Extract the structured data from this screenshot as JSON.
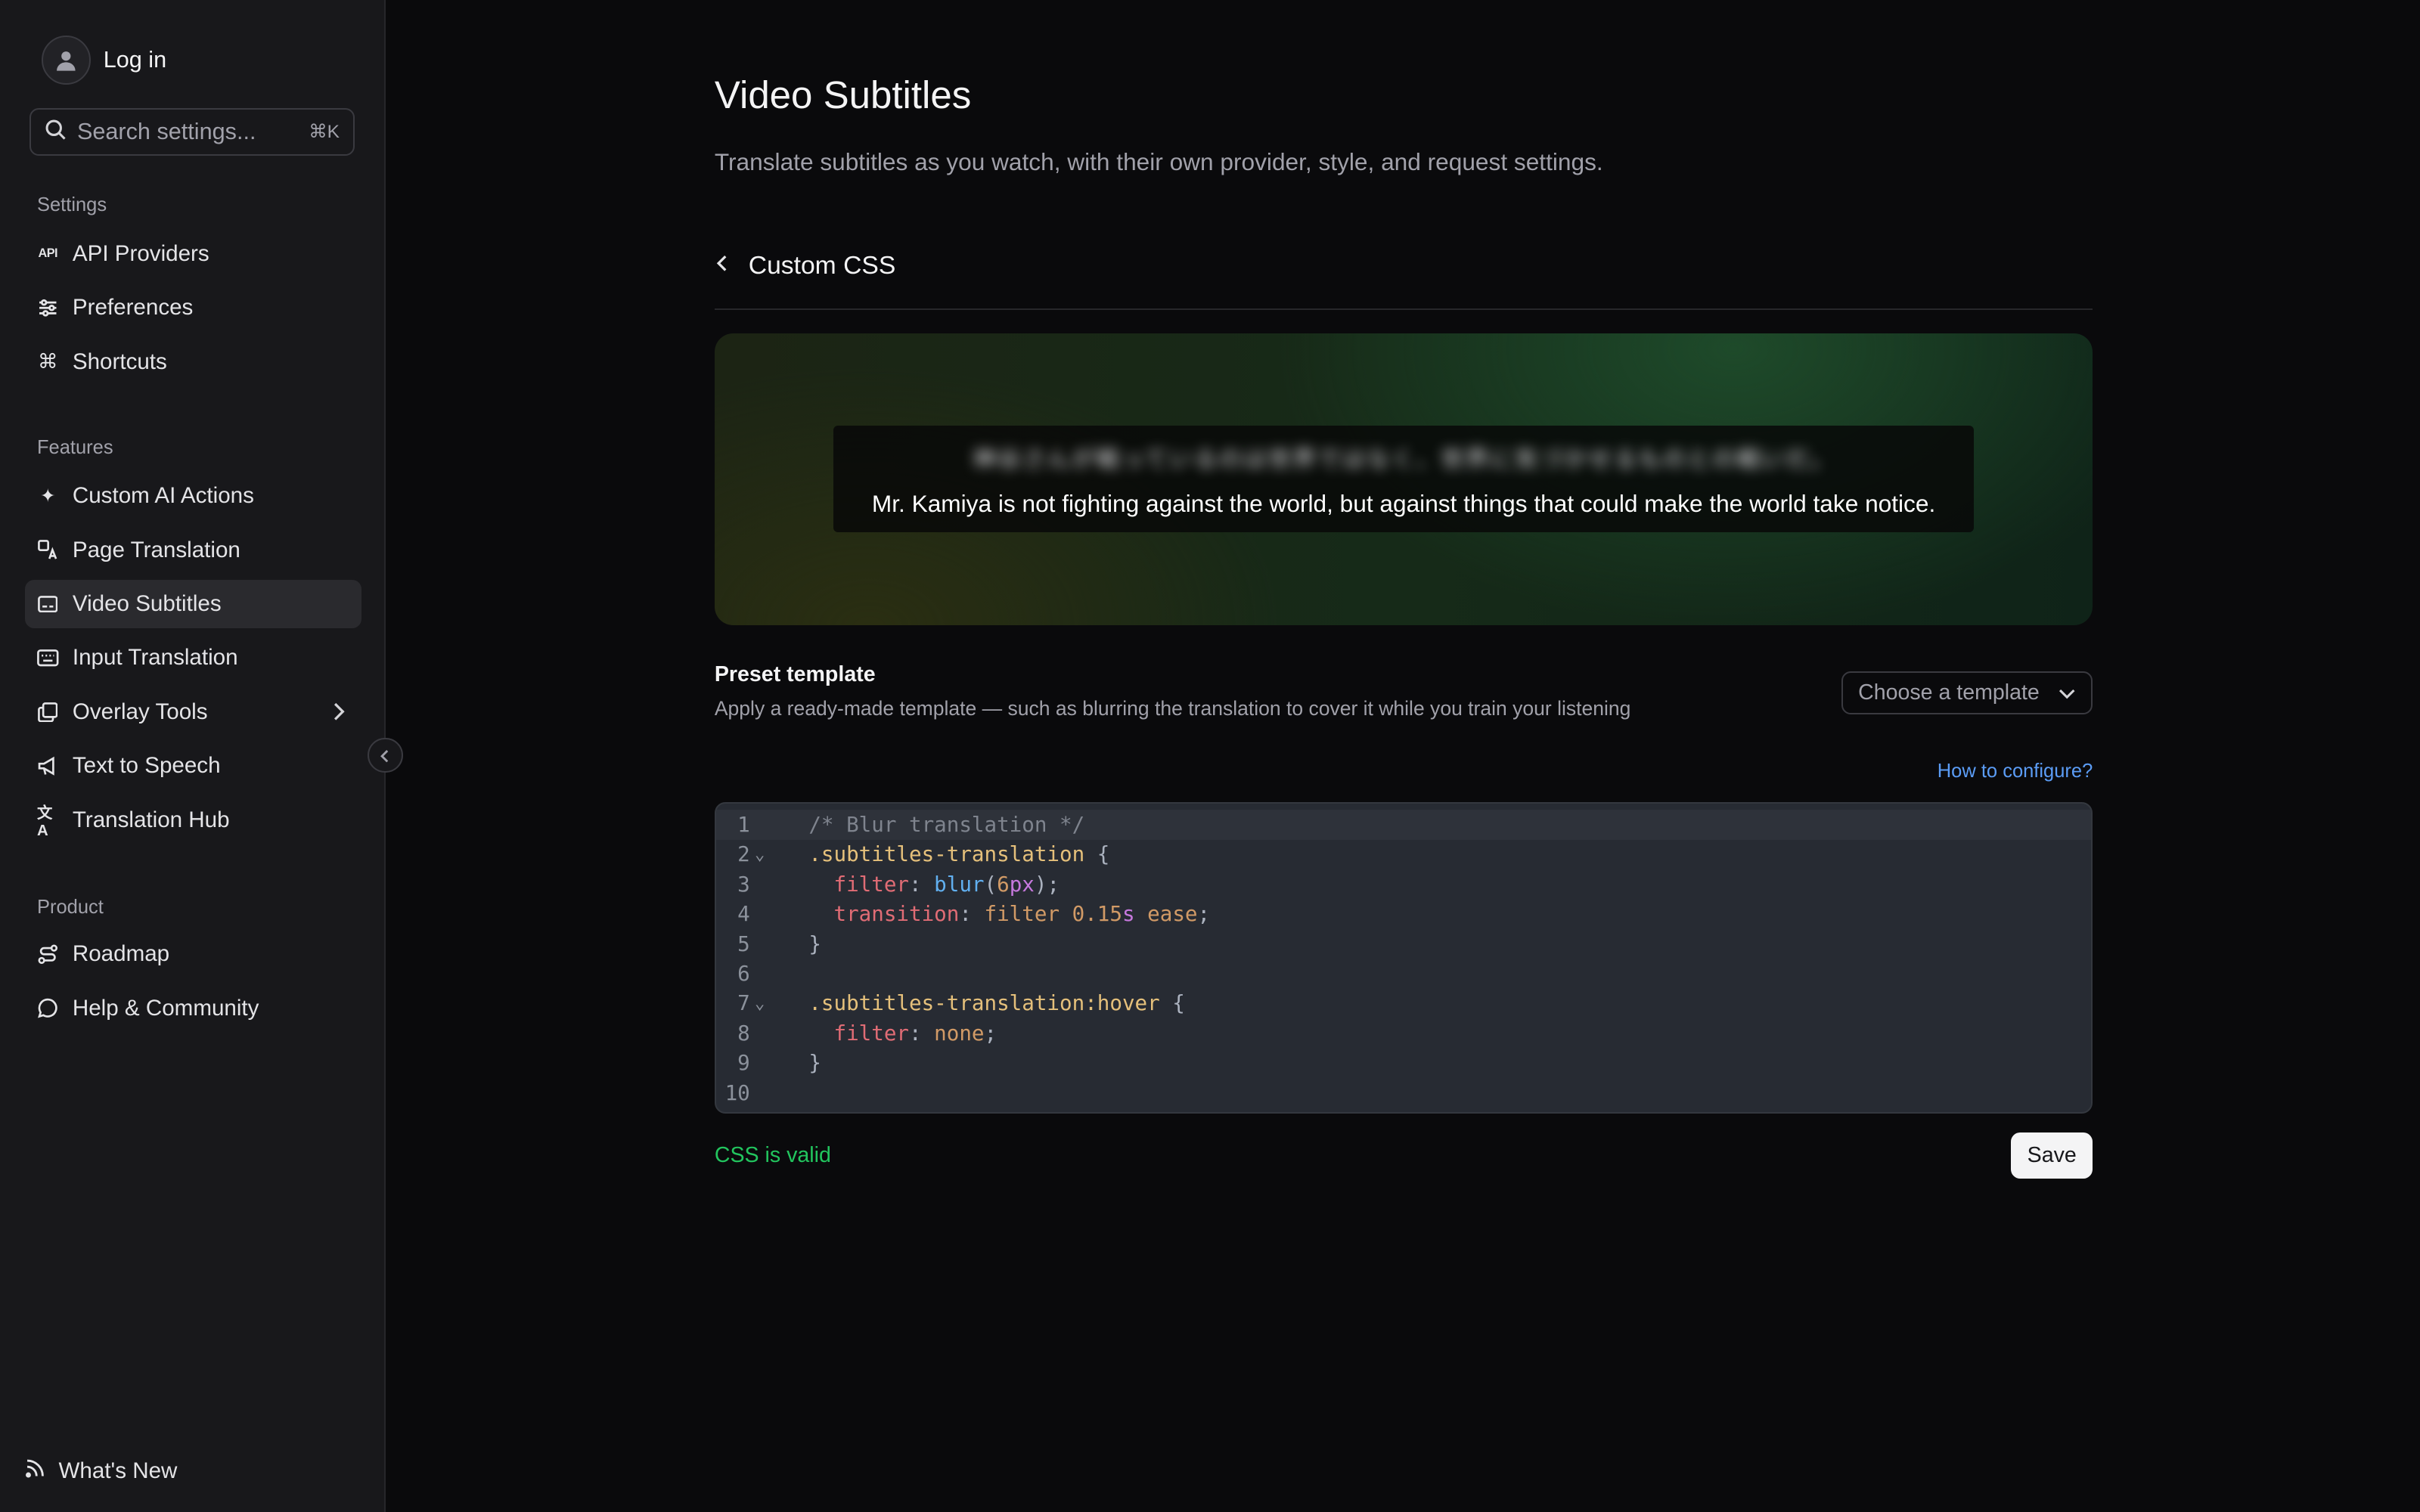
{
  "sidebar": {
    "login_label": "Log in",
    "search_placeholder": "Search settings...",
    "search_shortcut": "⌘K",
    "groups": {
      "settings": "Settings",
      "features": "Features",
      "product": "Product"
    },
    "settings_items": [
      {
        "label": "API Providers",
        "icon": "api-icon"
      },
      {
        "label": "Preferences",
        "icon": "sliders-icon"
      },
      {
        "label": "Shortcuts",
        "icon": "command-icon"
      }
    ],
    "feature_items": [
      {
        "label": "Custom AI Actions",
        "icon": "sparkles-icon"
      },
      {
        "label": "Page Translation",
        "icon": "translate-icon"
      },
      {
        "label": "Video Subtitles",
        "icon": "subtitles-icon",
        "active": true
      },
      {
        "label": "Input Translation",
        "icon": "keyboard-icon"
      },
      {
        "label": "Overlay Tools",
        "icon": "layers-icon"
      },
      {
        "label": "Text to Speech",
        "icon": "megaphone-icon"
      },
      {
        "label": "Translation Hub",
        "icon": "language-icon"
      }
    ],
    "product_items": [
      {
        "label": "Roadmap",
        "icon": "route-icon"
      },
      {
        "label": "Help & Community",
        "icon": "chat-icon"
      }
    ],
    "whats_new": "What's New"
  },
  "main": {
    "title": "Video Subtitles",
    "subtitle": "Translate subtitles as you watch, with their own provider, style, and request settings.",
    "section_title": "Custom CSS",
    "preview": {
      "original_text": "神谷さんが戦っているのは世界ではなく、世界に気づかせるものとの戦いだ。",
      "translation_text": "Mr. Kamiya is not fighting against the world, but against things that could make the world take notice."
    },
    "preset": {
      "title": "Preset template",
      "description": "Apply a ready-made template — such as blurring the translation to cover it while you train your listening",
      "select_placeholder": "Choose a template"
    },
    "how_to_link": "How to configure?",
    "editor": {
      "line_numbers": [
        "1",
        "2",
        "3",
        "4",
        "5",
        "6",
        "7",
        "8",
        "9",
        "10"
      ]
    },
    "status": "CSS is valid",
    "save_label": "Save"
  },
  "colors": {
    "accent_green": "#22c55e",
    "link_blue": "#5b9cf5",
    "sidebar_bg": "#18181b",
    "page_bg": "#0a0a0c"
  }
}
